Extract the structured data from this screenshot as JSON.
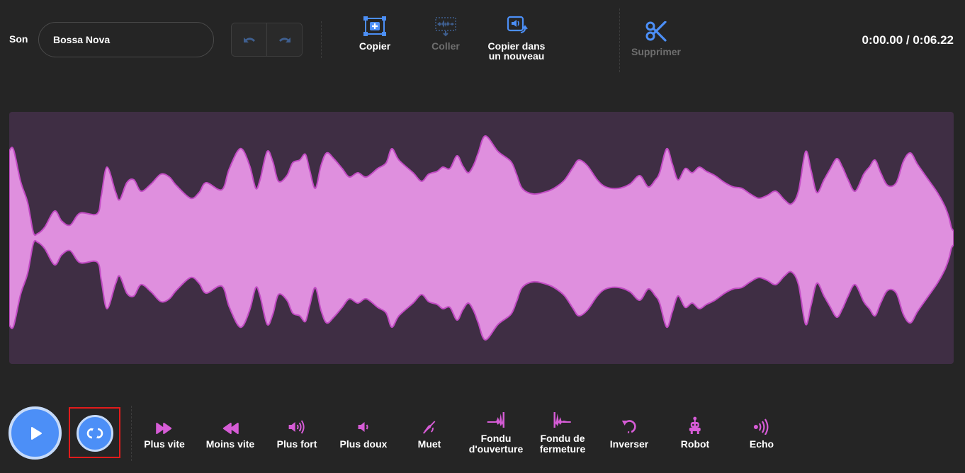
{
  "header": {
    "sound_label": "Son",
    "sound_name": "Bossa Nova",
    "undo_icon": "undo-icon",
    "redo_icon": "redo-icon",
    "tools": {
      "copy": "Copier",
      "paste": "Coller",
      "copy_new_line1": "Copier dans",
      "copy_new_line2": "un nouveau",
      "delete": "Supprimer"
    },
    "time_display": "0:00.00 / 0:06.22"
  },
  "effects": [
    {
      "label": "Plus vite",
      "icon": "fast-forward-icon"
    },
    {
      "label": "Moins vite",
      "icon": "rewind-icon"
    },
    {
      "label": "Plus fort",
      "icon": "volume-up-icon"
    },
    {
      "label": "Plus doux",
      "icon": "volume-down-icon"
    },
    {
      "label": "Muet",
      "icon": "mute-icon"
    },
    {
      "label_line1": "Fondu",
      "label_line2": "d'ouverture",
      "icon": "fade-in-icon"
    },
    {
      "label_line1": "Fondu de",
      "label_line2": "fermeture",
      "icon": "fade-out-icon"
    },
    {
      "label": "Inverser",
      "icon": "reverse-icon"
    },
    {
      "label": "Robot",
      "icon": "robot-icon"
    },
    {
      "label": "Echo",
      "icon": "echo-icon"
    }
  ],
  "colors": {
    "background": "#252525",
    "accent_blue": "#4c8ff7",
    "effect_pink": "#d65cd6",
    "wave_fill": "#df8fde",
    "wave_stroke": "#c24bc4",
    "wave_bg": "#3f2e44",
    "highlight_red": "#e21b1b"
  }
}
